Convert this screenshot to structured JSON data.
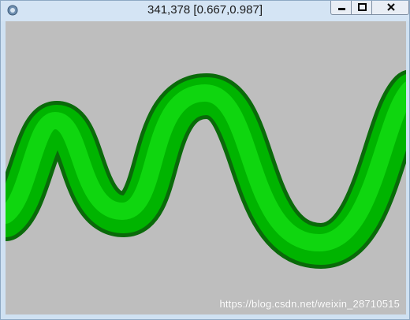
{
  "window": {
    "title": "341,378 [0.667,0.987]",
    "controls": {
      "minimize_icon": "minimize-icon",
      "maximize_icon": "maximize-icon",
      "close_icon": "close-icon"
    }
  },
  "canvas": {
    "background_color": "#bebebe",
    "tube_color": "#00c800",
    "tube_shadow_color": "#004d00",
    "watermark": "https://blog.csdn.net/weixin_28710515"
  }
}
